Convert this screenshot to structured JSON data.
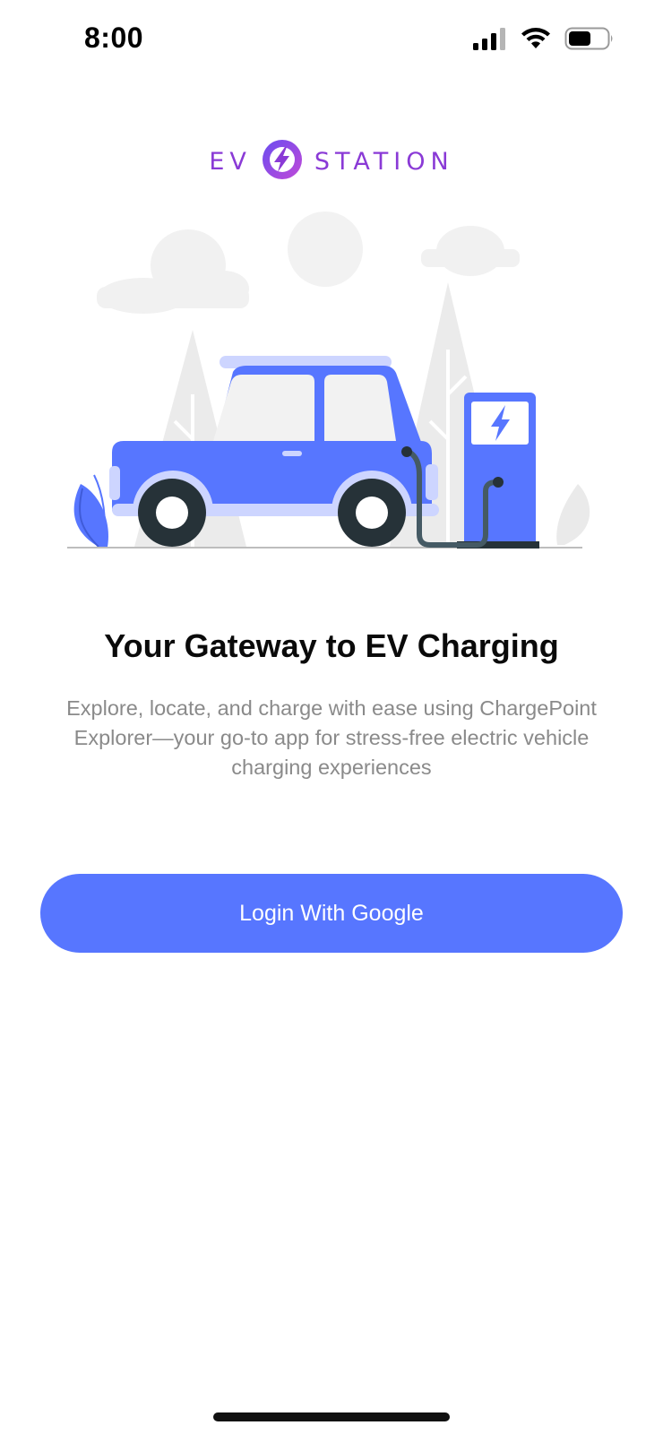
{
  "status_bar": {
    "time": "8:00",
    "icons": [
      "cellular-signal-icon",
      "wifi-icon",
      "battery-icon"
    ]
  },
  "logo": {
    "left_text": "EV",
    "right_text": "STATION",
    "icon": "lightning-bolt-icon",
    "colors": {
      "text": "#8a3ad6",
      "gradient_start": "#6a4cf0",
      "gradient_end": "#c04ad8"
    }
  },
  "illustration": {
    "description_icon": "ev-car-charging-illustration",
    "colors": {
      "car_body": "#5776ff",
      "car_accent": "#cdd5ff",
      "background_shapes": "#eeeeee",
      "tire": "#263238"
    }
  },
  "onboarding": {
    "title": "Your Gateway to EV Charging",
    "description": "Explore, locate, and charge with ease using ChargePoint Explorer—your go-to app for stress-free electric vehicle charging experiences"
  },
  "actions": {
    "login_label": "Login With Google"
  },
  "colors": {
    "primary": "#5776ff",
    "heading": "#0a0a0a",
    "body_text": "#8a8a8a"
  }
}
